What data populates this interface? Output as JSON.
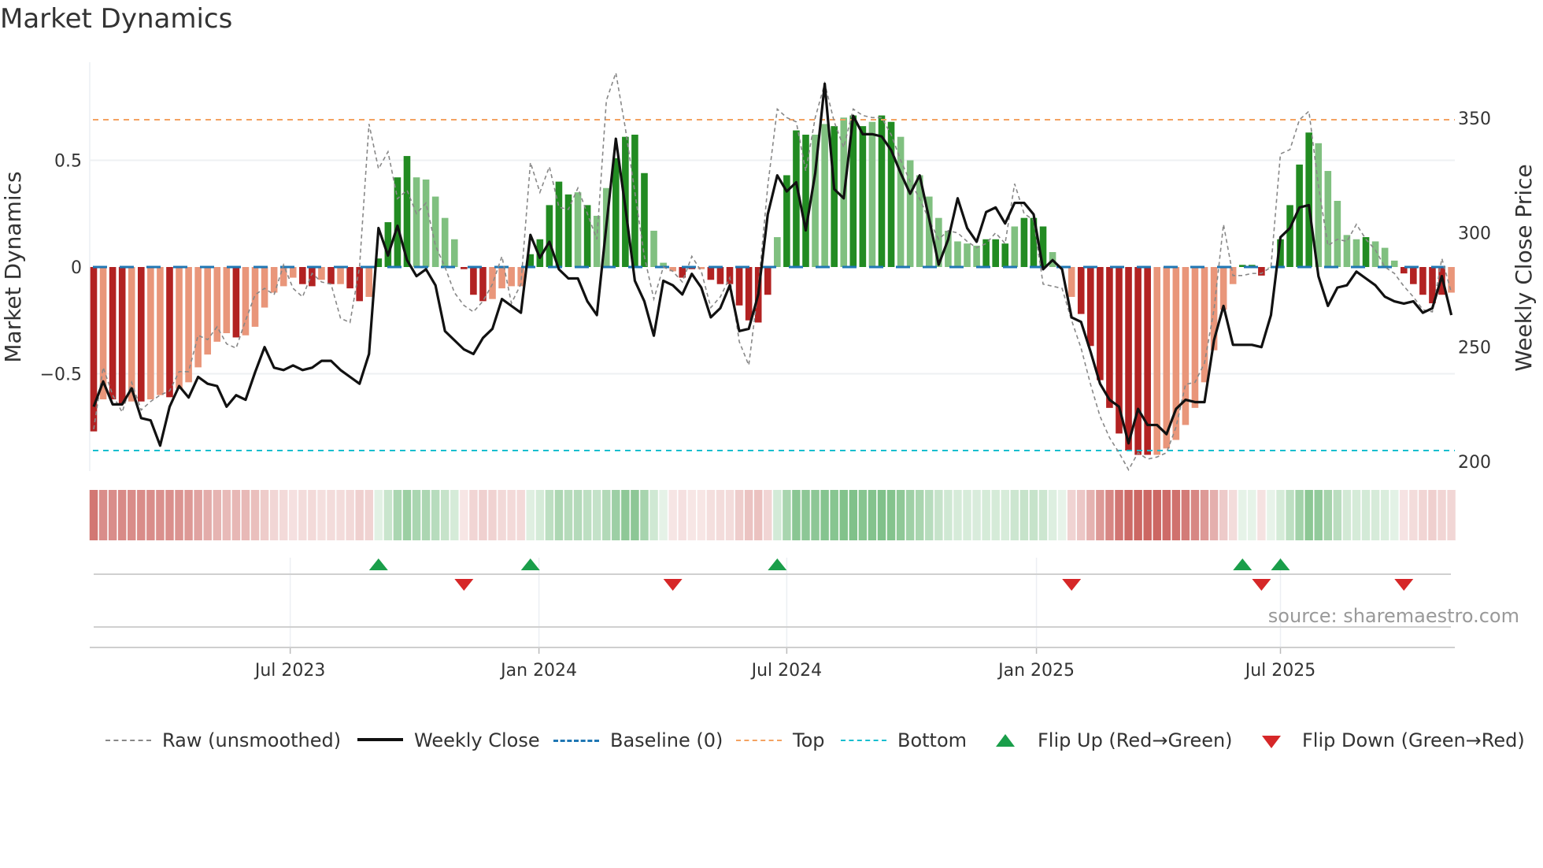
{
  "chart_data": {
    "type": "bar",
    "title": "Market Dynamics",
    "ylabel": "Market Dynamics",
    "ylabel_right": "Weekly Close Price",
    "ylim": [
      -0.96,
      0.92
    ],
    "ylim_right": [
      195,
      365
    ],
    "yticks_left": [
      {
        "value": 0.5,
        "label": "0.5"
      },
      {
        "value": 0,
        "label": "0"
      },
      {
        "value": -0.5,
        "label": "−0.5"
      }
    ],
    "yticks_right": [
      {
        "value": 350,
        "label": "350"
      },
      {
        "value": 300,
        "label": "300"
      },
      {
        "value": 250,
        "label": "250"
      },
      {
        "value": 200,
        "label": "200"
      }
    ],
    "x_unit": "week index",
    "x_ticks": [
      {
        "label": "Jul 2023",
        "week": 20.7
      },
      {
        "label": "Jan 2024",
        "week": 46.9
      },
      {
        "label": "Jul 2024",
        "week": 73.0
      },
      {
        "label": "Jan 2025",
        "week": 99.3
      },
      {
        "label": "Jul 2025",
        "week": 125.0
      }
    ],
    "grid": true,
    "thresholds": {
      "baseline": 0,
      "top": 0.69,
      "bottom": -0.86
    },
    "dynamics": [
      -0.77,
      -0.62,
      -0.62,
      -0.64,
      -0.63,
      -0.63,
      -0.62,
      -0.6,
      -0.61,
      -0.57,
      -0.54,
      -0.47,
      -0.41,
      -0.35,
      -0.31,
      -0.33,
      -0.32,
      -0.28,
      -0.19,
      -0.12,
      -0.09,
      -0.05,
      -0.08,
      -0.09,
      -0.06,
      -0.08,
      -0.08,
      -0.1,
      -0.16,
      -0.14,
      0.04,
      0.21,
      0.42,
      0.52,
      0.42,
      0.41,
      0.33,
      0.23,
      0.13,
      -0.01,
      -0.13,
      -0.16,
      -0.15,
      -0.1,
      -0.09,
      -0.09,
      0.06,
      0.13,
      0.29,
      0.4,
      0.34,
      0.35,
      0.29,
      0.24,
      0.37,
      0.51,
      0.61,
      0.62,
      0.44,
      0.17,
      0.02,
      -0.02,
      -0.05,
      -0.01,
      -0.01,
      -0.06,
      -0.08,
      -0.08,
      -0.18,
      -0.25,
      -0.26,
      -0.13,
      0.14,
      0.43,
      0.64,
      0.62,
      0.62,
      0.67,
      0.66,
      0.7,
      0.71,
      0.66,
      0.68,
      0.71,
      0.68,
      0.61,
      0.5,
      0.43,
      0.33,
      0.23,
      0.17,
      0.12,
      0.11,
      0.1,
      0.13,
      0.13,
      0.11,
      0.19,
      0.23,
      0.23,
      0.19,
      0.07,
      0.0,
      -0.14,
      -0.22,
      -0.37,
      -0.53,
      -0.66,
      -0.78,
      -0.86,
      -0.88,
      -0.88,
      -0.88,
      -0.85,
      -0.81,
      -0.74,
      -0.66,
      -0.54,
      -0.39,
      -0.2,
      -0.08,
      0.01,
      0.01,
      -0.04,
      0.0,
      0.13,
      0.29,
      0.48,
      0.63,
      0.58,
      0.45,
      0.31,
      0.15,
      0.13,
      0.14,
      0.12,
      0.09,
      0.03,
      -0.03,
      -0.08,
      -0.13,
      -0.17,
      -0.13,
      -0.12
    ],
    "shade": "dlddldlldlllllldllllllddldlddlddddllllldddlllldddddldllddddlllddldddddddldddlldlddlddllllllllldddldddlllddddddddllllllllldddlddddllllldllldddddll",
    "weekly_close": [
      224,
      235,
      225,
      225,
      232,
      219,
      218,
      207,
      224,
      233,
      228,
      237,
      234,
      233,
      224,
      229,
      227,
      239,
      250,
      241,
      240,
      242,
      240,
      241,
      244,
      244,
      240,
      237,
      234,
      247,
      302,
      290,
      303,
      288,
      281,
      284,
      277,
      257,
      253,
      249,
      247,
      254,
      258,
      271,
      268,
      265,
      299,
      289,
      296,
      284,
      280,
      280,
      270,
      264,
      303,
      341,
      311,
      279,
      270,
      255,
      279,
      277,
      273,
      282,
      276,
      263,
      267,
      277,
      257,
      258,
      273,
      308,
      325,
      318,
      322,
      301,
      326,
      365,
      319,
      315,
      351,
      343,
      343,
      342,
      336,
      326,
      317,
      325,
      306,
      286,
      297,
      315,
      302,
      296,
      309,
      311,
      304,
      313,
      313,
      308,
      284,
      288,
      284,
      263,
      261,
      248,
      234,
      227,
      224,
      208,
      223,
      216,
      216,
      212,
      223,
      227,
      226,
      226,
      253,
      268,
      251,
      251,
      251,
      250,
      264,
      298,
      302,
      311,
      312,
      281,
      268,
      276,
      277,
      283,
      280,
      277,
      272,
      270,
      269,
      270,
      265,
      267,
      281,
      264
    ],
    "raw": [
      -0.76,
      -0.47,
      -0.6,
      -0.68,
      -0.54,
      -0.67,
      -0.63,
      -0.6,
      -0.58,
      -0.49,
      -0.49,
      -0.32,
      -0.34,
      -0.28,
      -0.36,
      -0.38,
      -0.25,
      -0.13,
      -0.1,
      -0.13,
      0.01,
      -0.1,
      -0.14,
      -0.03,
      -0.07,
      -0.08,
      -0.24,
      -0.26,
      0.0,
      0.67,
      0.46,
      0.54,
      0.32,
      0.36,
      0.25,
      0.3,
      0.1,
      0.0,
      -0.12,
      -0.18,
      -0.21,
      -0.16,
      -0.08,
      0.05,
      -0.17,
      -0.08,
      0.49,
      0.35,
      0.47,
      0.28,
      0.27,
      0.37,
      0.25,
      0.13,
      0.78,
      0.91,
      0.65,
      0.35,
      0.05,
      -0.15,
      0.0,
      -0.02,
      -0.07,
      0.05,
      -0.02,
      -0.19,
      -0.14,
      -0.05,
      -0.35,
      -0.46,
      -0.1,
      0.38,
      0.74,
      0.7,
      0.68,
      0.45,
      0.7,
      0.86,
      0.68,
      0.56,
      0.74,
      0.71,
      0.7,
      0.7,
      0.62,
      0.5,
      0.4,
      0.32,
      0.22,
      0.13,
      0.17,
      0.16,
      0.12,
      0.09,
      0.11,
      0.16,
      0.11,
      0.39,
      0.25,
      0.22,
      -0.08,
      -0.09,
      -0.1,
      -0.25,
      -0.38,
      -0.55,
      -0.7,
      -0.8,
      -0.87,
      -0.95,
      -0.87,
      -0.9,
      -0.89,
      -0.87,
      -0.75,
      -0.55,
      -0.54,
      -0.45,
      -0.2,
      0.2,
      -0.04,
      -0.04,
      -0.03,
      -0.03,
      0.0,
      0.53,
      0.55,
      0.69,
      0.73,
      0.38,
      0.1,
      0.13,
      0.12,
      0.2,
      0.13,
      0.08,
      0.0,
      -0.03,
      -0.09,
      -0.14,
      -0.2,
      -0.21,
      0.04,
      -0.12
    ],
    "flip_up_weeks": [
      31,
      47,
      73,
      122,
      126
    ],
    "flip_down_weeks": [
      40,
      62,
      104,
      124,
      139
    ],
    "colors": {
      "pos_strong": "#228b22",
      "pos_weak": "#80c080",
      "neg_strong": "#b22222",
      "neg_weak": "#e9967a",
      "close": "#111111",
      "raw": "#888888",
      "baseline": "#1f77b4",
      "top": "#f4a261",
      "bottom": "#17becf",
      "flip_up": "#1a9e4a",
      "flip_down": "#d62728"
    },
    "legend": [
      {
        "label": "Raw (unsmoothed)"
      },
      {
        "label": "Weekly Close"
      },
      {
        "label": "Baseline (0)"
      },
      {
        "label": "Top"
      },
      {
        "label": "Bottom"
      },
      {
        "label": "Flip Up (Red→Green)"
      },
      {
        "label": "Flip Down (Green→Red)"
      }
    ],
    "legend_placement": "bottom",
    "source": "source: sharemaestro.com"
  }
}
